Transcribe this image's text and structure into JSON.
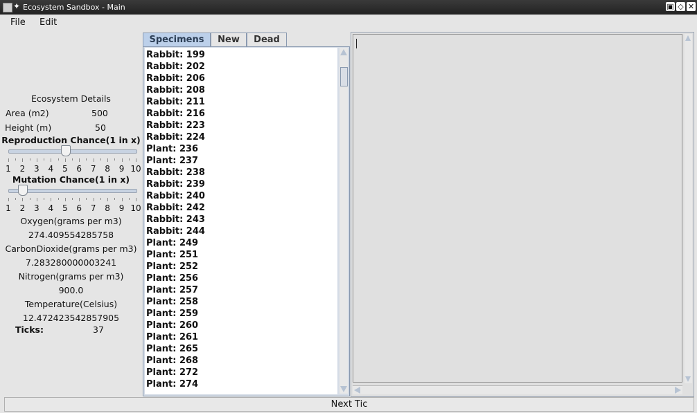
{
  "window": {
    "title": "Ecosystem Sandbox - Main",
    "controls": [
      "restore-icon",
      "maximize-icon",
      "close-icon"
    ]
  },
  "menu": {
    "file": "File",
    "edit": "Edit"
  },
  "details": {
    "heading": "Ecosystem Details",
    "area_label": "Area (m2)",
    "area_value": "500",
    "height_label": "Height (m)",
    "height_value": "50",
    "reproduction": {
      "label": "Reproduction Chance(1 in x)",
      "value": 5,
      "min": 1,
      "max": 10,
      "ticks": [
        "1",
        "2",
        "3",
        "4",
        "5",
        "6",
        "7",
        "8",
        "9",
        "10"
      ]
    },
    "mutation": {
      "label": "Mutation Chance(1 in x)",
      "value": 2,
      "min": 1,
      "max": 10,
      "ticks": [
        "1",
        "2",
        "3",
        "4",
        "5",
        "6",
        "7",
        "8",
        "9",
        "10"
      ]
    },
    "oxygen_label": "Oxygen(grams per m3)",
    "oxygen_value": "274.409554285758",
    "co2_label": "CarbonDioxide(grams per m3)",
    "co2_value": "7.283280000003241",
    "nitrogen_label": "Nitrogen(grams per m3)",
    "nitrogen_value": "900.0",
    "temp_label": "Temperature(Celsius)",
    "temp_value": "12.472423542857905",
    "ticks_label": "Ticks:",
    "ticks_value": "37"
  },
  "tabs": {
    "specimens": "Specimens",
    "new": "New",
    "dead": "Dead",
    "active": "specimens"
  },
  "specimens": [
    "Rabbit: 199",
    "Rabbit: 202",
    "Rabbit: 206",
    "Rabbit: 208",
    "Rabbit: 211",
    "Rabbit: 216",
    "Rabbit: 223",
    "Rabbit: 224",
    "Plant: 236",
    "Plant: 237",
    "Rabbit: 238",
    "Rabbit: 239",
    "Rabbit: 240",
    "Rabbit: 242",
    "Rabbit: 243",
    "Rabbit: 244",
    "Plant: 249",
    "Plant: 251",
    "Plant: 252",
    "Plant: 256",
    "Plant: 257",
    "Plant: 258",
    "Plant: 259",
    "Plant: 260",
    "Plant: 261",
    "Plant: 265",
    "Plant: 268",
    "Plant: 272",
    "Plant: 274"
  ],
  "next_button": "Next Tic",
  "colors": {
    "titlebar": "#2a2a2a",
    "tab_active": "#bcd0ea",
    "panel": "#e5e5e5"
  }
}
